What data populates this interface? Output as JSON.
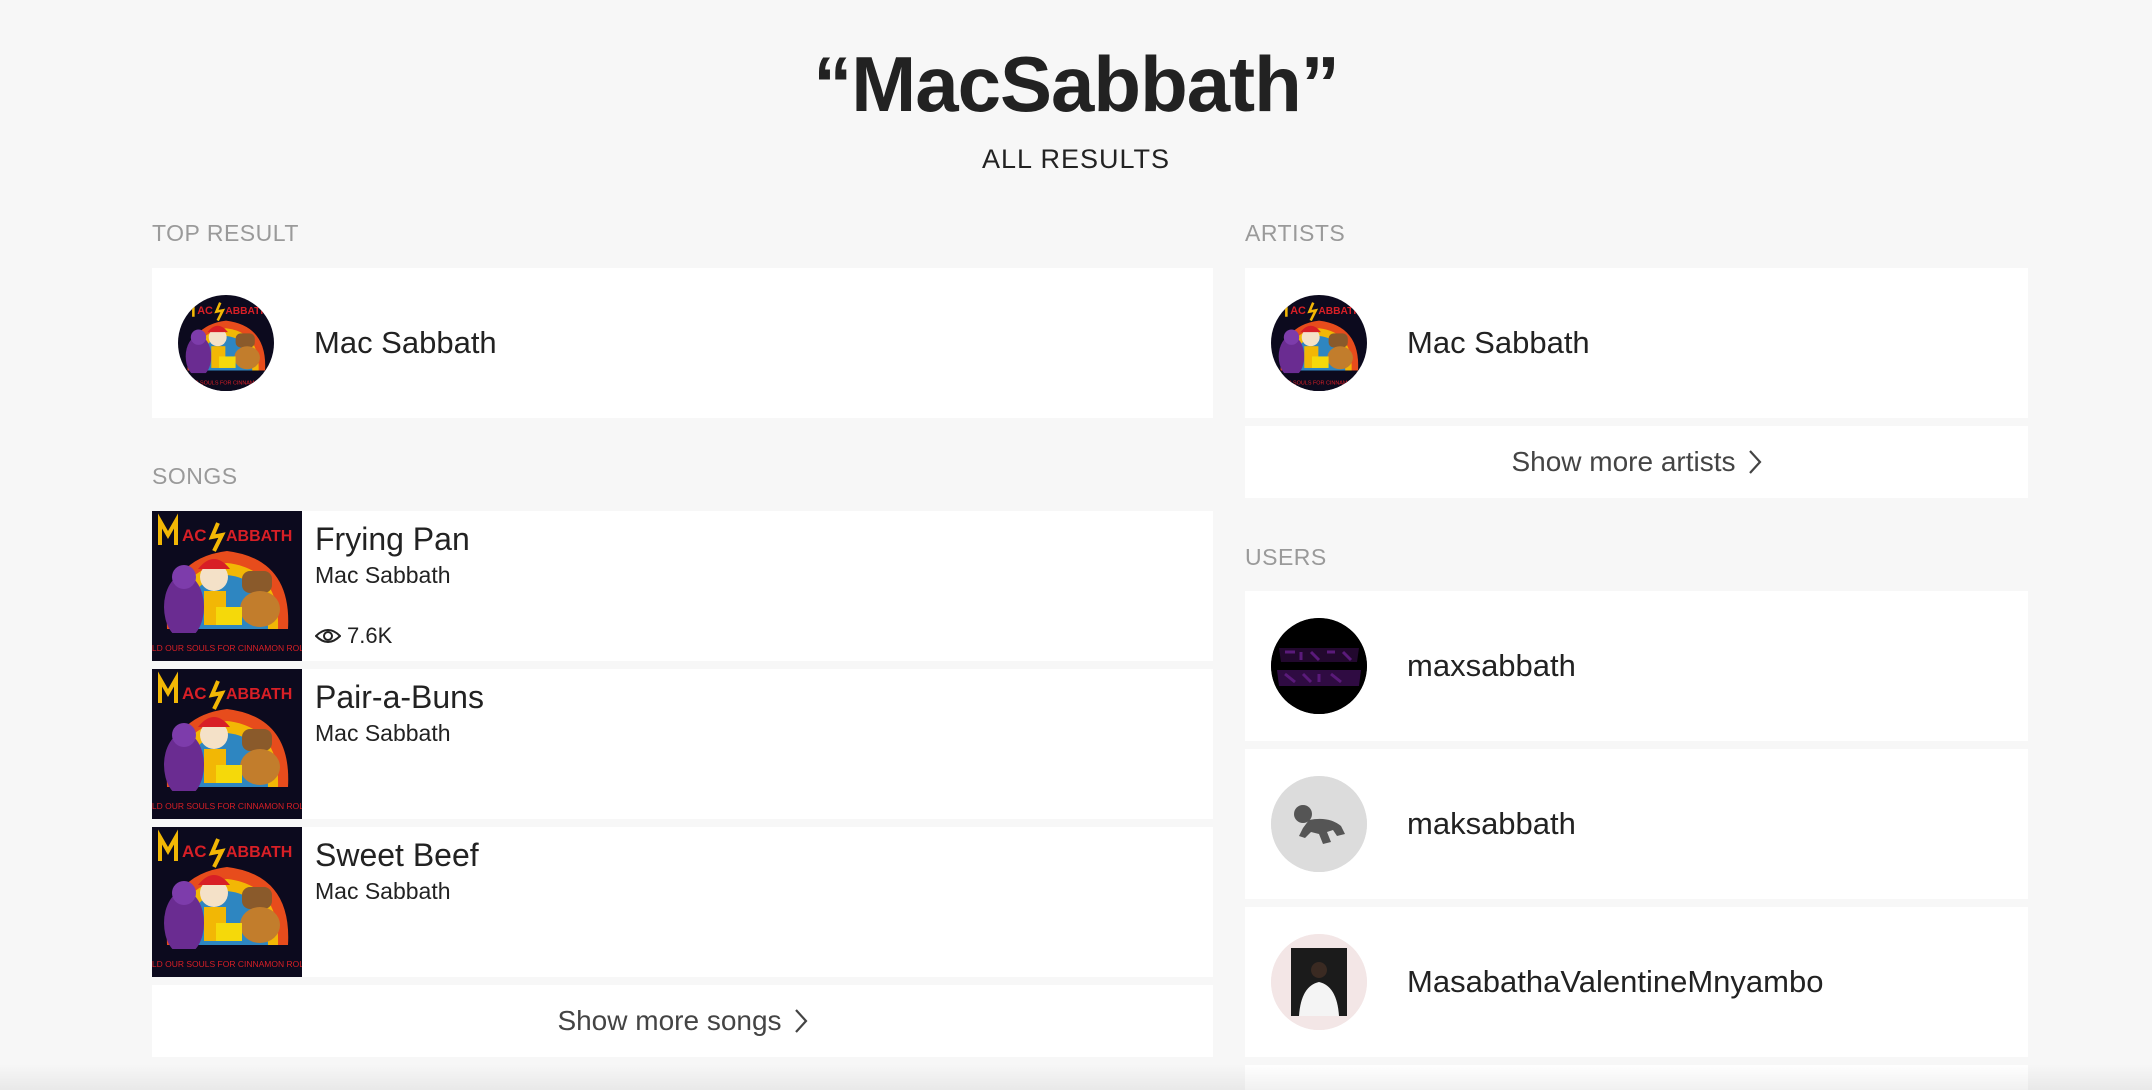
{
  "search": {
    "query": "“MacSabbath”",
    "filter_label": "ALL RESULTS"
  },
  "top_result": {
    "section_label": "TOP RESULT",
    "name": "Mac Sabbath"
  },
  "songs": {
    "section_label": "SONGS",
    "items": [
      {
        "title": "Frying Pan",
        "artist": "Mac Sabbath",
        "views": "7.6K"
      },
      {
        "title": "Pair-a-Buns",
        "artist": "Mac Sabbath"
      },
      {
        "title": "Sweet Beef",
        "artist": "Mac Sabbath"
      }
    ],
    "show_more": "Show more songs"
  },
  "artists": {
    "section_label": "ARTISTS",
    "items": [
      {
        "name": "Mac Sabbath"
      }
    ],
    "show_more": "Show more artists"
  },
  "users": {
    "section_label": "USERS",
    "items": [
      {
        "name": "maxsabbath"
      },
      {
        "name": "maksabbath"
      },
      {
        "name": "MasabathaValentineMnyambo"
      }
    ]
  },
  "colors": {
    "background": "#f7f7f7",
    "card": "#ffffff",
    "label": "#9a9a9a",
    "text": "#222222"
  },
  "icons": [
    "eye-icon",
    "chevron-right-icon"
  ]
}
